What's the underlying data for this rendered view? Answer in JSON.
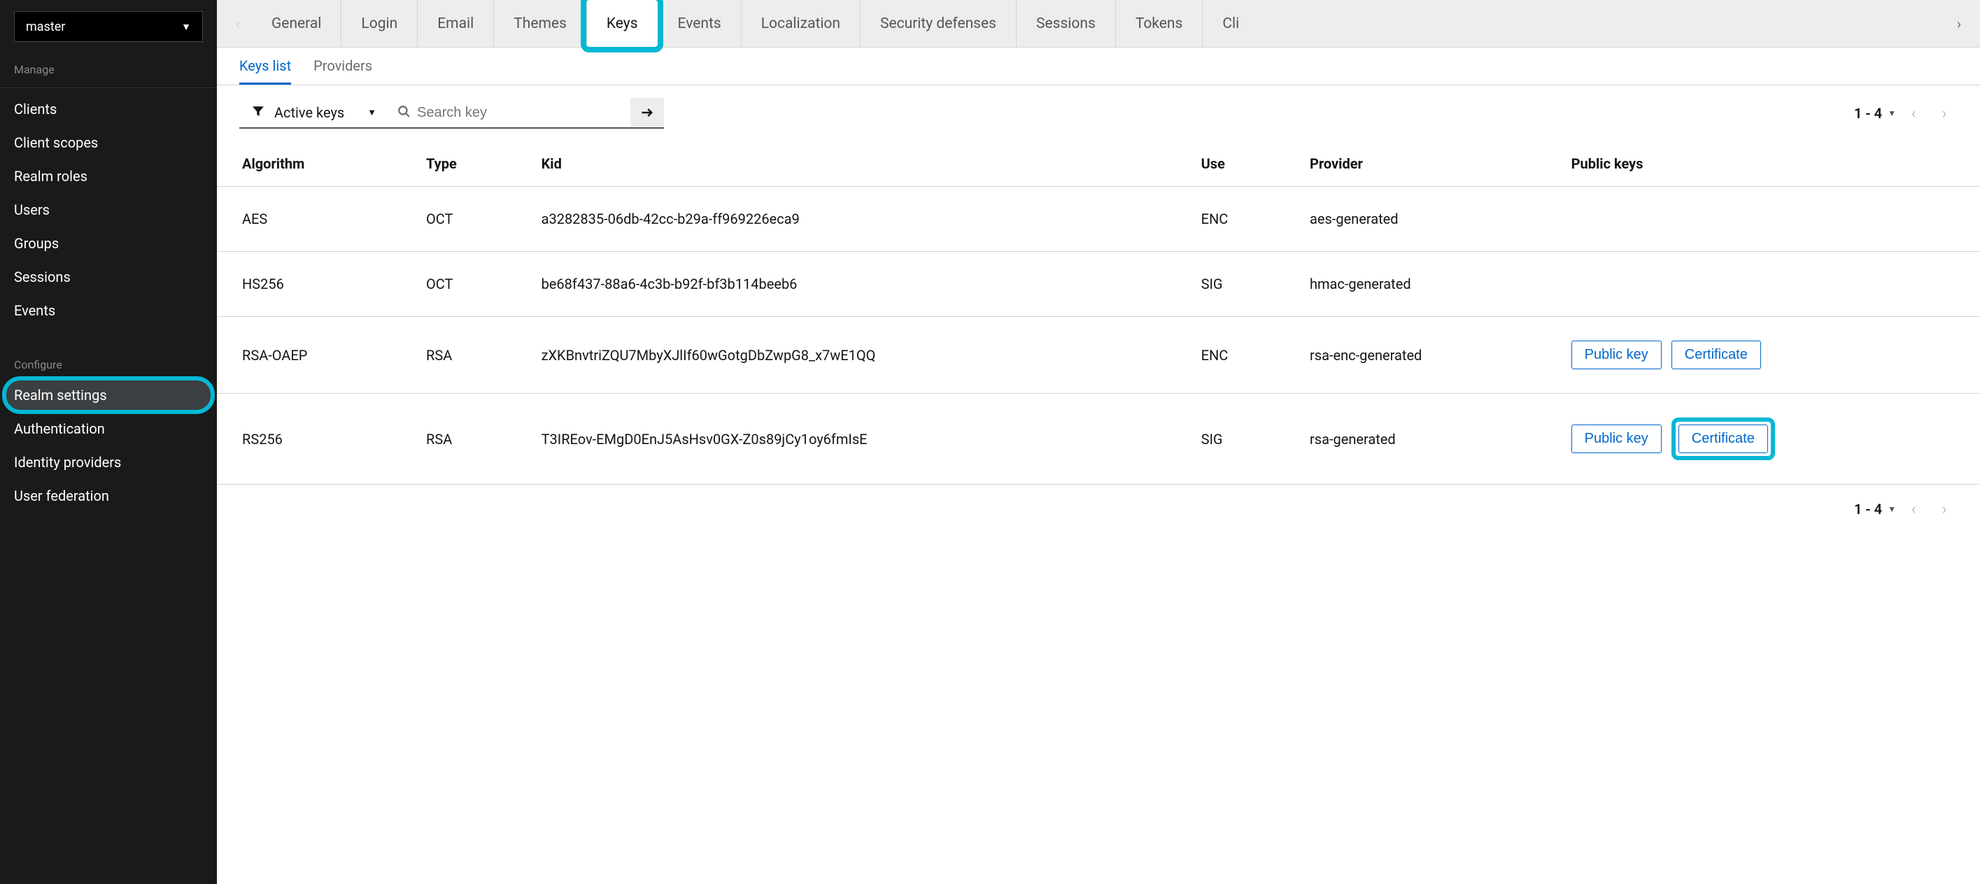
{
  "sidebar": {
    "realm": "master",
    "manage_label": "Manage",
    "configure_label": "Configure",
    "manage_items": [
      {
        "label": "Clients"
      },
      {
        "label": "Client scopes"
      },
      {
        "label": "Realm roles"
      },
      {
        "label": "Users"
      },
      {
        "label": "Groups"
      },
      {
        "label": "Sessions"
      },
      {
        "label": "Events"
      }
    ],
    "configure_items": [
      {
        "label": "Realm settings",
        "active": true
      },
      {
        "label": "Authentication"
      },
      {
        "label": "Identity providers"
      },
      {
        "label": "User federation"
      }
    ]
  },
  "tabs": {
    "items": [
      {
        "label": "General"
      },
      {
        "label": "Login"
      },
      {
        "label": "Email"
      },
      {
        "label": "Themes"
      },
      {
        "label": "Keys",
        "active": true,
        "highlighted": true
      },
      {
        "label": "Events"
      },
      {
        "label": "Localization"
      },
      {
        "label": "Security defenses"
      },
      {
        "label": "Sessions"
      },
      {
        "label": "Tokens"
      },
      {
        "label": "Cli"
      }
    ]
  },
  "subtabs": {
    "items": [
      {
        "label": "Keys list",
        "active": true
      },
      {
        "label": "Providers"
      }
    ]
  },
  "toolbar": {
    "filter_label": "Active keys",
    "search_placeholder": "Search key",
    "pager_range": "1 - 4"
  },
  "table": {
    "headers": {
      "algorithm": "Algorithm",
      "type": "Type",
      "kid": "Kid",
      "use": "Use",
      "provider": "Provider",
      "public_keys": "Public keys"
    },
    "public_key_btn": "Public key",
    "certificate_btn": "Certificate",
    "rows": [
      {
        "algorithm": "AES",
        "type": "OCT",
        "kid": "a3282835-06db-42cc-b29a-ff969226eca9",
        "use": "ENC",
        "provider": "aes-generated",
        "has_public": false
      },
      {
        "algorithm": "HS256",
        "type": "OCT",
        "kid": "be68f437-88a6-4c3b-b92f-bf3b114beeb6",
        "use": "SIG",
        "provider": "hmac-generated",
        "has_public": false
      },
      {
        "algorithm": "RSA-OAEP",
        "type": "RSA",
        "kid": "zXKBnvtriZQU7MbyXJlIf60wGotgDbZwpG8_x7wE1QQ",
        "use": "ENC",
        "provider": "rsa-enc-generated",
        "has_public": true,
        "cert_highlighted": false
      },
      {
        "algorithm": "RS256",
        "type": "RSA",
        "kid": "T3IREov-EMgD0EnJ5AsHsv0GX-Z0s89jCy1oy6fmIsE",
        "use": "SIG",
        "provider": "rsa-generated",
        "has_public": true,
        "cert_highlighted": true
      }
    ]
  },
  "bottom_pager": {
    "range": "1 - 4"
  }
}
